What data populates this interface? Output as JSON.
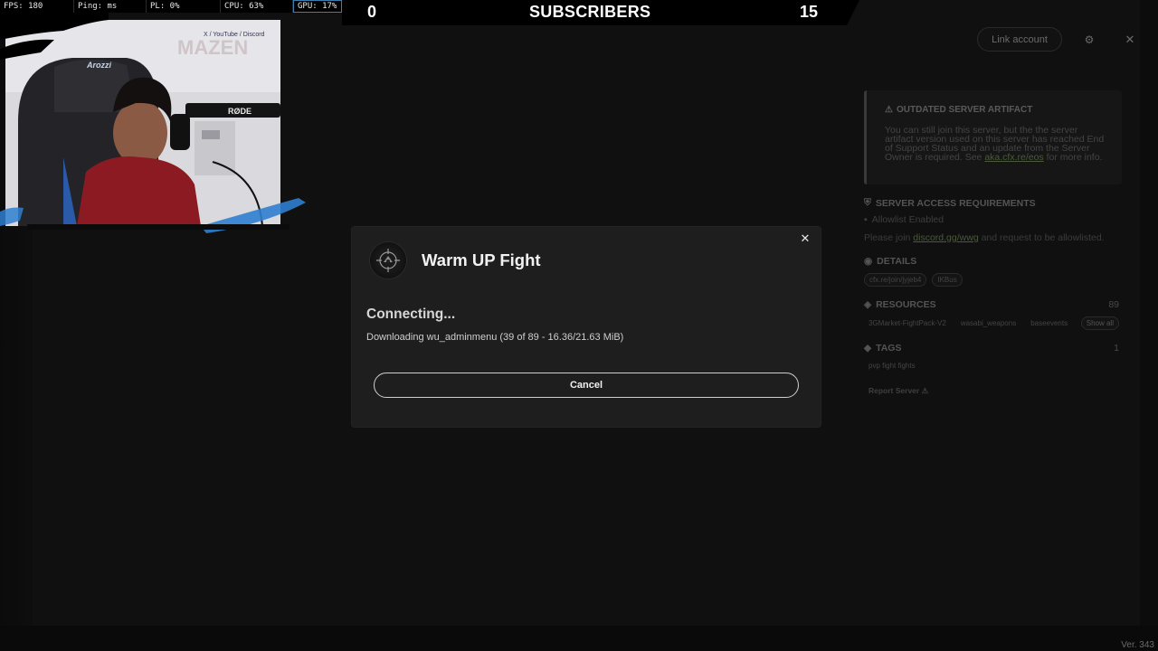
{
  "perf": {
    "fps": "FPS: 180",
    "ping": "Ping: ms",
    "pl": "PL: 0%",
    "cpu": "CPU: 63%",
    "gpu": "GPU: 17%"
  },
  "subscribers": {
    "left_value": "0",
    "label": "SUBSCRIBERS",
    "right_value": "15"
  },
  "header": {
    "link_account_label": "Link account",
    "settings_icon": "gear-icon",
    "close_icon": "close-icon"
  },
  "server_panel": {
    "warning_title": "OUTDATED SERVER ARTIFACT",
    "warning_text": "You can still join this server, but the the server artifact version used on this server has reached End of Support Status and an update from the Server Owner is required. See",
    "warning_link": "aka.cfx.re/eos",
    "warning_suffix": "for more info.",
    "access_title": "SERVER ACCESS REQUIREMENTS",
    "allowlist_label": "Allowlist Enabled",
    "join_text_prefix": "Please join",
    "join_link": "discord.gg/wwg",
    "join_text_suffix": "and request to be allowlisted.",
    "details_title": "DETAILS",
    "details_chips": [
      "cfx.re/join/jyjeb4",
      "IKBus"
    ],
    "resources_title": "RESOURCES",
    "resources_count": "89",
    "resources_chips": [
      "3GMarket-FightPack-V2",
      "wasabi_weapons",
      "baseevents"
    ],
    "show_all_label": "Show all",
    "tags_title": "TAGS",
    "tags_count": "1",
    "tags_chip": "pvp fight fights",
    "report_label": "Report Server"
  },
  "modal": {
    "server_name": "Warm UP Fight",
    "status_title": "Connecting...",
    "status_detail": "Downloading wu_adminmenu (39 of 89 - 16.36/21.63 MiB)",
    "cancel_label": "Cancel",
    "close_icon": "close-icon",
    "logo_icon": "server-logo-icon"
  },
  "webcam": {
    "brand_text": "MAZEN",
    "mic_brand": "RØDE",
    "chair_brand": "Arozzi",
    "social_text": "X / YouTube / Discord"
  },
  "footer": {
    "version": "Ver. 343"
  }
}
